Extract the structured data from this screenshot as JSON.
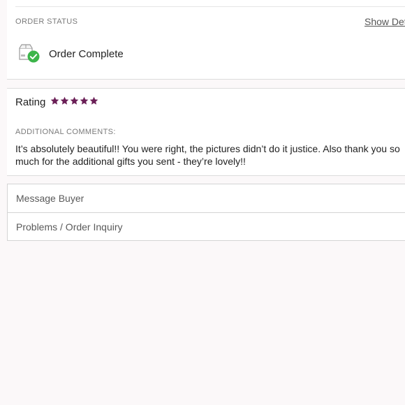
{
  "order_status": {
    "section_label": "ORDER STATUS",
    "show_details_label": "Show Det",
    "status_icon": "box-checkmark-icon",
    "status_text": "Order Complete",
    "check_color": "#3cb54a"
  },
  "review": {
    "rating_label": "Rating",
    "rating_value": 5,
    "rating_max": 5,
    "star_icon": "star-icon",
    "star_color": "#6b1f57",
    "comments_label": "ADDITIONAL COMMENTS:",
    "comment_text": "It’s absolutely beautiful!! You were right, the pictures didn’t do it justice. Also thank you so much for the additional gifts you sent - they’re lovely!!"
  },
  "actions": [
    {
      "label": "Message Buyer"
    },
    {
      "label": "Problems / Order Inquiry"
    }
  ]
}
